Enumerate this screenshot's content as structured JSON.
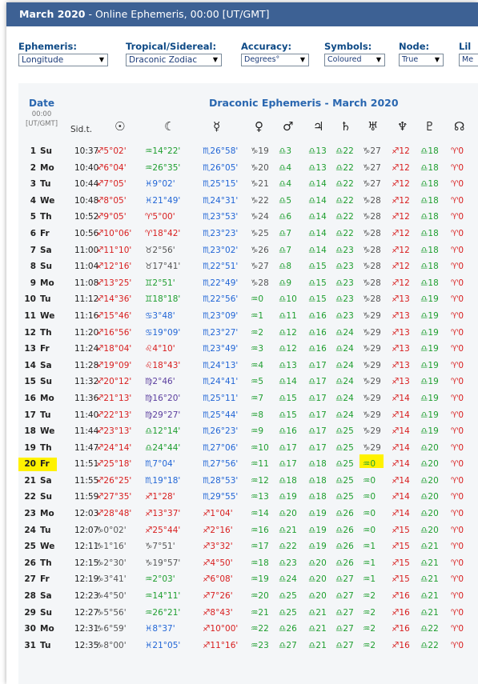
{
  "header": {
    "title_bold": "March 2020",
    "title_rest": " - Online Ephemeris, 00:00 [UT/GMT]"
  },
  "controls": {
    "ephemeris": {
      "label": "Ephemeris:",
      "value": "Longitude"
    },
    "tropical": {
      "label": "Tropical/Sidereal:",
      "value": "Draconic Zodiac"
    },
    "accuracy": {
      "label": "Accuracy:",
      "value": "Degrees°"
    },
    "symbols": {
      "label": "Symbols:",
      "value": "Coloured"
    },
    "node": {
      "label": "Node:",
      "value": "True"
    },
    "lilith": {
      "label": "Lil",
      "value": "Me"
    }
  },
  "table": {
    "date_header": "Date",
    "time_header": "00:00",
    "tz_header": "[UT/GMT]",
    "title": "Draconic Ephemeris - March 2020",
    "sidt_header": "Sid.t.",
    "planet_glyphs": [
      "☉",
      "☾",
      "☿",
      "♀",
      "♂",
      "♃",
      "♄",
      "♅",
      "♆",
      "♇",
      "☊"
    ],
    "highlight_day": 20,
    "rows": [
      {
        "d": "1",
        "w": "Su",
        "s": "10:37",
        "sun": "♐5°02'",
        "moon": "♒14°22'",
        "mer": "♏26°58'",
        "ven": "♑19",
        "mar": "♎3",
        "jup": "♎13",
        "sat": "♎22",
        "ura": "♑27",
        "nep": "♐12",
        "plu": "♎18",
        "node": "♈0"
      },
      {
        "d": "2",
        "w": "Mo",
        "s": "10:40",
        "sun": "♐6°04'",
        "moon": "♒26°35'",
        "mer": "♏26°05'",
        "ven": "♑20",
        "mar": "♎4",
        "jup": "♎13",
        "sat": "♎22",
        "ura": "♑27",
        "nep": "♐12",
        "plu": "♎18",
        "node": "♈0"
      },
      {
        "d": "3",
        "w": "Tu",
        "s": "10:44",
        "sun": "♐7°05'",
        "moon": "♓9°02'",
        "mer": "♏25°15'",
        "ven": "♑21",
        "mar": "♎4",
        "jup": "♎14",
        "sat": "♎22",
        "ura": "♑27",
        "nep": "♐12",
        "plu": "♎18",
        "node": "♈0"
      },
      {
        "d": "4",
        "w": "We",
        "s": "10:48",
        "sun": "♐8°05'",
        "moon": "♓21°49'",
        "mer": "♏24°31'",
        "ven": "♑22",
        "mar": "♎5",
        "jup": "♎14",
        "sat": "♎22",
        "ura": "♑28",
        "nep": "♐12",
        "plu": "♎18",
        "node": "♈0"
      },
      {
        "d": "5",
        "w": "Th",
        "s": "10:52",
        "sun": "♐9°05'",
        "moon": "♈5°00'",
        "mer": "♏23°53'",
        "ven": "♑24",
        "mar": "♎6",
        "jup": "♎14",
        "sat": "♎22",
        "ura": "♑28",
        "nep": "♐12",
        "plu": "♎18",
        "node": "♈0"
      },
      {
        "d": "6",
        "w": "Fr",
        "s": "10:56",
        "sun": "♐10°06'",
        "moon": "♈18°42'",
        "mer": "♏23°23'",
        "ven": "♑25",
        "mar": "♎7",
        "jup": "♎14",
        "sat": "♎22",
        "ura": "♑28",
        "nep": "♐12",
        "plu": "♎18",
        "node": "♈0"
      },
      {
        "d": "7",
        "w": "Sa",
        "s": "11:00",
        "sun": "♐11°10'",
        "moon": "♉2°56'",
        "mer": "♏23°02'",
        "ven": "♑26",
        "mar": "♎7",
        "jup": "♎14",
        "sat": "♎23",
        "ura": "♑28",
        "nep": "♐12",
        "plu": "♎18",
        "node": "♈0"
      },
      {
        "d": "8",
        "w": "Su",
        "s": "11:04",
        "sun": "♐12°16'",
        "moon": "♉17°41'",
        "mer": "♏22°51'",
        "ven": "♑27",
        "mar": "♎8",
        "jup": "♎15",
        "sat": "♎23",
        "ura": "♑28",
        "nep": "♐12",
        "plu": "♎18",
        "node": "♈0"
      },
      {
        "d": "9",
        "w": "Mo",
        "s": "11:08",
        "sun": "♐13°25'",
        "moon": "♊2°51'",
        "mer": "♏22°49'",
        "ven": "♑28",
        "mar": "♎9",
        "jup": "♎15",
        "sat": "♎23",
        "ura": "♑28",
        "nep": "♐12",
        "plu": "♎18",
        "node": "♈0"
      },
      {
        "d": "10",
        "w": "Tu",
        "s": "11:12",
        "sun": "♐14°36'",
        "moon": "♊18°18'",
        "mer": "♏22°56'",
        "ven": "♒0",
        "mar": "♎10",
        "jup": "♎15",
        "sat": "♎23",
        "ura": "♑28",
        "nep": "♐13",
        "plu": "♎19",
        "node": "♈0"
      },
      {
        "d": "11",
        "w": "We",
        "s": "11:16",
        "sun": "♐15°46'",
        "moon": "♋3°48'",
        "mer": "♏23°09'",
        "ven": "♒1",
        "mar": "♎11",
        "jup": "♎16",
        "sat": "♎23",
        "ura": "♑29",
        "nep": "♐13",
        "plu": "♎19",
        "node": "♈0"
      },
      {
        "d": "12",
        "w": "Th",
        "s": "11:20",
        "sun": "♐16°56'",
        "moon": "♋19°09'",
        "mer": "♏23°27'",
        "ven": "♒2",
        "mar": "♎12",
        "jup": "♎16",
        "sat": "♎24",
        "ura": "♑29",
        "nep": "♐13",
        "plu": "♎19",
        "node": "♈0"
      },
      {
        "d": "13",
        "w": "Fr",
        "s": "11:24",
        "sun": "♐18°04'",
        "moon": "♌4°10'",
        "mer": "♏23°49'",
        "ven": "♒3",
        "mar": "♎12",
        "jup": "♎16",
        "sat": "♎24",
        "ura": "♑29",
        "nep": "♐13",
        "plu": "♎19",
        "node": "♈0"
      },
      {
        "d": "14",
        "w": "Sa",
        "s": "11:28",
        "sun": "♐19°09'",
        "moon": "♌18°43'",
        "mer": "♏24°13'",
        "ven": "♒4",
        "mar": "♎13",
        "jup": "♎17",
        "sat": "♎24",
        "ura": "♑29",
        "nep": "♐13",
        "plu": "♎19",
        "node": "♈0"
      },
      {
        "d": "15",
        "w": "Su",
        "s": "11:32",
        "sun": "♐20°12'",
        "moon": "♍2°46'",
        "mer": "♏24°41'",
        "ven": "♒5",
        "mar": "♎14",
        "jup": "♎17",
        "sat": "♎24",
        "ura": "♑29",
        "nep": "♐13",
        "plu": "♎19",
        "node": "♈0"
      },
      {
        "d": "16",
        "w": "Mo",
        "s": "11:36",
        "sun": "♐21°13'",
        "moon": "♍16°20'",
        "mer": "♏25°11'",
        "ven": "♒7",
        "mar": "♎15",
        "jup": "♎17",
        "sat": "♎24",
        "ura": "♑29",
        "nep": "♐14",
        "plu": "♎19",
        "node": "♈0"
      },
      {
        "d": "17",
        "w": "Tu",
        "s": "11:40",
        "sun": "♐22°13'",
        "moon": "♍29°27'",
        "mer": "♏25°44'",
        "ven": "♒8",
        "mar": "♎15",
        "jup": "♎17",
        "sat": "♎24",
        "ura": "♑29",
        "nep": "♐14",
        "plu": "♎19",
        "node": "♈0"
      },
      {
        "d": "18",
        "w": "We",
        "s": "11:44",
        "sun": "♐23°13'",
        "moon": "♎12°14'",
        "mer": "♏26°23'",
        "ven": "♒9",
        "mar": "♎16",
        "jup": "♎17",
        "sat": "♎25",
        "ura": "♑29",
        "nep": "♐14",
        "plu": "♎19",
        "node": "♈0"
      },
      {
        "d": "19",
        "w": "Th",
        "s": "11:47",
        "sun": "♐24°14'",
        "moon": "♎24°44'",
        "mer": "♏27°06'",
        "ven": "♒10",
        "mar": "♎17",
        "jup": "♎17",
        "sat": "♎25",
        "ura": "♑29",
        "nep": "♐14",
        "plu": "♎20",
        "node": "♈0"
      },
      {
        "d": "20",
        "w": "Fr",
        "s": "11:51",
        "sun": "♐25°18'",
        "moon": "♏7°04'",
        "mer": "♏27°56'",
        "ven": "♒11",
        "mar": "♎17",
        "jup": "♎18",
        "sat": "♎25",
        "ura": "♒0",
        "nep": "♐14",
        "plu": "♎20",
        "node": "♈0"
      },
      {
        "d": "21",
        "w": "Sa",
        "s": "11:55",
        "sun": "♐26°25'",
        "moon": "♏19°18'",
        "mer": "♏28°53'",
        "ven": "♒12",
        "mar": "♎18",
        "jup": "♎18",
        "sat": "♎25",
        "ura": "♒0",
        "nep": "♐14",
        "plu": "♎20",
        "node": "♈0"
      },
      {
        "d": "22",
        "w": "Su",
        "s": "11:59",
        "sun": "♐27°35'",
        "moon": "♐1°28'",
        "mer": "♏29°55'",
        "ven": "♒13",
        "mar": "♎19",
        "jup": "♎18",
        "sat": "♎25",
        "ura": "♒0",
        "nep": "♐14",
        "plu": "♎20",
        "node": "♈0"
      },
      {
        "d": "23",
        "w": "Mo",
        "s": "12:03",
        "sun": "♐28°48'",
        "moon": "♐13°37'",
        "mer": "♐1°04'",
        "ven": "♒14",
        "mar": "♎20",
        "jup": "♎19",
        "sat": "♎26",
        "ura": "♒0",
        "nep": "♐14",
        "plu": "♎20",
        "node": "♈0"
      },
      {
        "d": "24",
        "w": "Tu",
        "s": "12:07",
        "sun": "♑0°02'",
        "moon": "♐25°44'",
        "mer": "♐2°16'",
        "ven": "♒16",
        "mar": "♎21",
        "jup": "♎19",
        "sat": "♎26",
        "ura": "♒0",
        "nep": "♐15",
        "plu": "♎20",
        "node": "♈0"
      },
      {
        "d": "25",
        "w": "We",
        "s": "12:11",
        "sun": "♑1°16'",
        "moon": "♑7°51'",
        "mer": "♐3°32'",
        "ven": "♒17",
        "mar": "♎22",
        "jup": "♎19",
        "sat": "♎26",
        "ura": "♒1",
        "nep": "♐15",
        "plu": "♎21",
        "node": "♈0"
      },
      {
        "d": "26",
        "w": "Th",
        "s": "12:15",
        "sun": "♑2°30'",
        "moon": "♑19°57'",
        "mer": "♐4°50'",
        "ven": "♒18",
        "mar": "♎23",
        "jup": "♎20",
        "sat": "♎26",
        "ura": "♒1",
        "nep": "♐15",
        "plu": "♎21",
        "node": "♈0"
      },
      {
        "d": "27",
        "w": "Fr",
        "s": "12:19",
        "sun": "♑3°41'",
        "moon": "♒2°03'",
        "mer": "♐6°08'",
        "ven": "♒19",
        "mar": "♎24",
        "jup": "♎20",
        "sat": "♎27",
        "ura": "♒1",
        "nep": "♐15",
        "plu": "♎21",
        "node": "♈0"
      },
      {
        "d": "28",
        "w": "Sa",
        "s": "12:23",
        "sun": "♑4°50'",
        "moon": "♒14°11'",
        "mer": "♐7°26'",
        "ven": "♒20",
        "mar": "♎25",
        "jup": "♎20",
        "sat": "♎27",
        "ura": "♒2",
        "nep": "♐16",
        "plu": "♎21",
        "node": "♈0"
      },
      {
        "d": "29",
        "w": "Su",
        "s": "12:27",
        "sun": "♑5°56'",
        "moon": "♒26°21'",
        "mer": "♐8°43'",
        "ven": "♒21",
        "mar": "♎25",
        "jup": "♎21",
        "sat": "♎27",
        "ura": "♒2",
        "nep": "♐16",
        "plu": "♎21",
        "node": "♈0"
      },
      {
        "d": "30",
        "w": "Mo",
        "s": "12:31",
        "sun": "♑6°59'",
        "moon": "♓8°37'",
        "mer": "♐10°00'",
        "ven": "♒22",
        "mar": "♎26",
        "jup": "♎21",
        "sat": "♎27",
        "ura": "♒2",
        "nep": "♐16",
        "plu": "♎22",
        "node": "♈0"
      },
      {
        "d": "31",
        "w": "Tu",
        "s": "12:35",
        "sun": "♑8°00'",
        "moon": "♓21°05'",
        "mer": "♐11°16'",
        "ven": "♒23",
        "mar": "♎27",
        "jup": "♎21",
        "sat": "♎27",
        "ura": "♒2",
        "nep": "♐16",
        "plu": "♎22",
        "node": "♈0"
      }
    ]
  }
}
